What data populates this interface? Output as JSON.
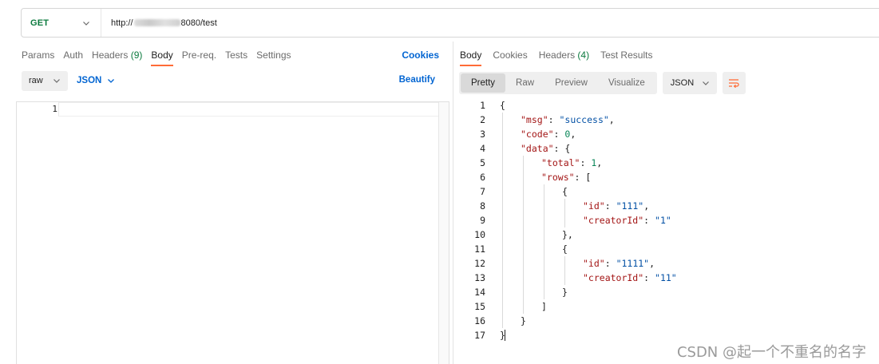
{
  "request": {
    "method": "GET",
    "url_prefix": "http://",
    "url_suffix": "8080/test"
  },
  "request_tabs": [
    {
      "label": "Params",
      "count": ""
    },
    {
      "label": "Auth",
      "count": ""
    },
    {
      "label": "Headers",
      "count": "(9)"
    },
    {
      "label": "Body",
      "count": "",
      "active": true
    },
    {
      "label": "Pre-req.",
      "count": ""
    },
    {
      "label": "Tests",
      "count": ""
    },
    {
      "label": "Settings",
      "count": ""
    }
  ],
  "cookies_label": "Cookies",
  "body_options": {
    "mode": "raw",
    "language": "JSON",
    "beautify_label": "Beautify"
  },
  "request_editor": {
    "line_numbers": [
      "1"
    ]
  },
  "response_tabs": [
    {
      "label": "Body",
      "count": "",
      "active": true
    },
    {
      "label": "Cookies",
      "count": ""
    },
    {
      "label": "Headers",
      "count": "(4)"
    },
    {
      "label": "Test Results",
      "count": ""
    }
  ],
  "response_view": {
    "modes": [
      "Pretty",
      "Raw",
      "Preview",
      "Visualize"
    ],
    "active_mode": "Pretty",
    "format": "JSON",
    "wrap_icon": "wrap-lines-icon"
  },
  "response_body": [
    {
      "n": "1",
      "indent": 0,
      "parts": [
        [
          "p",
          "{"
        ]
      ]
    },
    {
      "n": "2",
      "indent": 1,
      "parts": [
        [
          "k",
          "\"msg\""
        ],
        [
          "p",
          ": "
        ],
        [
          "s",
          "\"success\""
        ],
        [
          "p",
          ","
        ]
      ]
    },
    {
      "n": "3",
      "indent": 1,
      "parts": [
        [
          "k",
          "\"code\""
        ],
        [
          "p",
          ": "
        ],
        [
          "n",
          "0"
        ],
        [
          "p",
          ","
        ]
      ]
    },
    {
      "n": "4",
      "indent": 1,
      "parts": [
        [
          "k",
          "\"data\""
        ],
        [
          "p",
          ": {"
        ]
      ]
    },
    {
      "n": "5",
      "indent": 2,
      "parts": [
        [
          "k",
          "\"total\""
        ],
        [
          "p",
          ": "
        ],
        [
          "n",
          "1"
        ],
        [
          "p",
          ","
        ]
      ]
    },
    {
      "n": "6",
      "indent": 2,
      "parts": [
        [
          "k",
          "\"rows\""
        ],
        [
          "p",
          ": ["
        ]
      ]
    },
    {
      "n": "7",
      "indent": 3,
      "parts": [
        [
          "p",
          "{"
        ]
      ]
    },
    {
      "n": "8",
      "indent": 4,
      "parts": [
        [
          "k",
          "\"id\""
        ],
        [
          "p",
          ": "
        ],
        [
          "s",
          "\"111\""
        ],
        [
          "p",
          ","
        ]
      ]
    },
    {
      "n": "9",
      "indent": 4,
      "parts": [
        [
          "k",
          "\"creatorId\""
        ],
        [
          "p",
          ": "
        ],
        [
          "s",
          "\"1\""
        ]
      ]
    },
    {
      "n": "10",
      "indent": 3,
      "parts": [
        [
          "p",
          "},"
        ]
      ]
    },
    {
      "n": "11",
      "indent": 3,
      "parts": [
        [
          "p",
          "{"
        ]
      ]
    },
    {
      "n": "12",
      "indent": 4,
      "parts": [
        [
          "k",
          "\"id\""
        ],
        [
          "p",
          ": "
        ],
        [
          "s",
          "\"1111\""
        ],
        [
          "p",
          ","
        ]
      ]
    },
    {
      "n": "13",
      "indent": 4,
      "parts": [
        [
          "k",
          "\"creatorId\""
        ],
        [
          "p",
          ": "
        ],
        [
          "s",
          "\"11\""
        ]
      ]
    },
    {
      "n": "14",
      "indent": 3,
      "parts": [
        [
          "p",
          "}"
        ]
      ]
    },
    {
      "n": "15",
      "indent": 2,
      "parts": [
        [
          "p",
          "]"
        ]
      ]
    },
    {
      "n": "16",
      "indent": 1,
      "parts": [
        [
          "p",
          "}"
        ]
      ]
    },
    {
      "n": "17",
      "indent": 0,
      "parts": [
        [
          "p",
          "}"
        ]
      ]
    }
  ],
  "watermark": "CSDN @起一个不重名的名字",
  "colors": {
    "accent": "#ff6c37",
    "link": "#0265d2",
    "method_get": "#0b7a3e",
    "json_key": "#a31515",
    "json_string": "#0451a5",
    "json_number": "#098658"
  }
}
